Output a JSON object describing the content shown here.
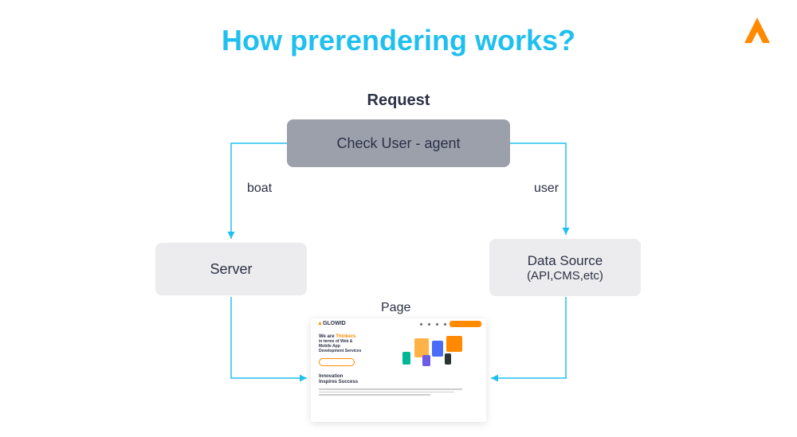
{
  "title": "How prerendering works?",
  "labels": {
    "request": "Request",
    "check_user": "Check User  - agent",
    "boat": "boat",
    "user": "user",
    "server": "Server",
    "datasource_title": "Data Source",
    "datasource_sub": "(API,CMS,etc)",
    "page": "Page"
  },
  "preview": {
    "brand": "GLOWID",
    "headline_word": "Thinkers",
    "headline_pre": "We are ",
    "subline1": "in terms of Web &",
    "subline2": "Mobile App",
    "subline3": "Development Services",
    "footer1": "Innovation",
    "footer2": "Inspires Success"
  },
  "colors": {
    "accent": "#1fc0ef",
    "logo": "#ff8a00",
    "dark": "#2b3146",
    "box_light": "#ececee",
    "box_dark": "#9ca0ab"
  }
}
